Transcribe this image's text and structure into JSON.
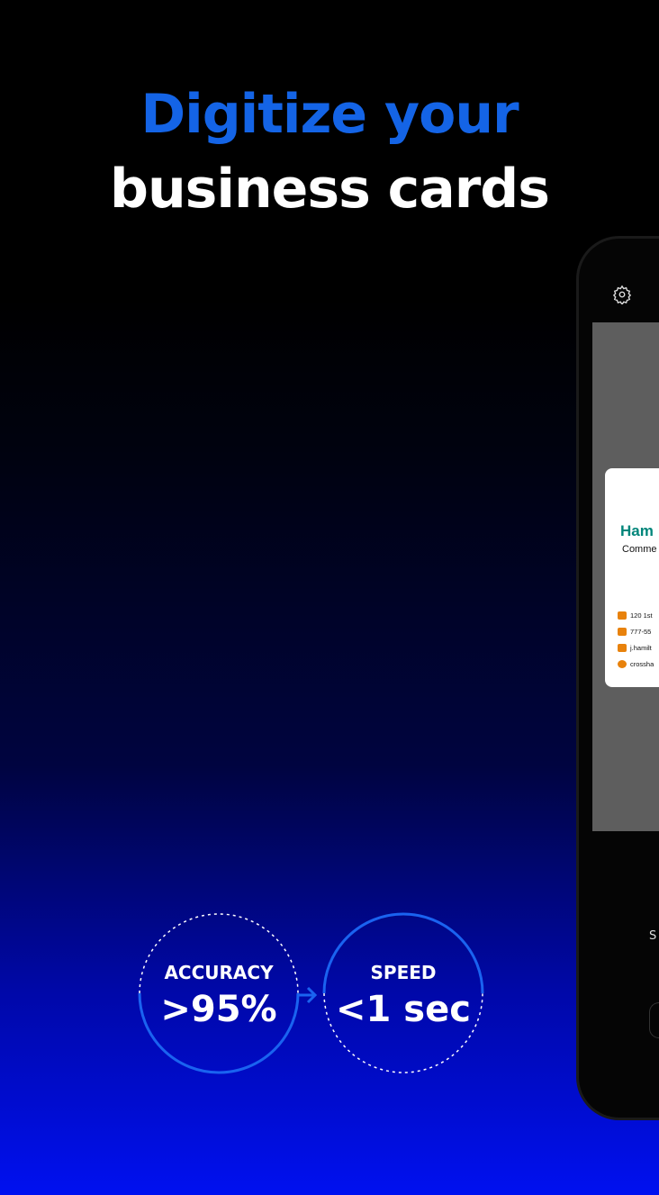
{
  "headline": {
    "line1": "Digitize your",
    "line2": "business cards"
  },
  "colors": {
    "accent": "#1464e6",
    "card_name": "#00857a",
    "icon_orange": "#e8820c"
  },
  "phone": {
    "settings_icon": "gear-icon",
    "card": {
      "name": "Ham",
      "title": "Comme",
      "address": "120 1st",
      "phone": "777-55",
      "email": "j.hamilt",
      "website": "crossha"
    },
    "bottom_label": "S"
  },
  "stats": [
    {
      "label": "ACCURACY",
      "value": ">95%"
    },
    {
      "label": "SPEED",
      "value": "<1 sec"
    }
  ]
}
